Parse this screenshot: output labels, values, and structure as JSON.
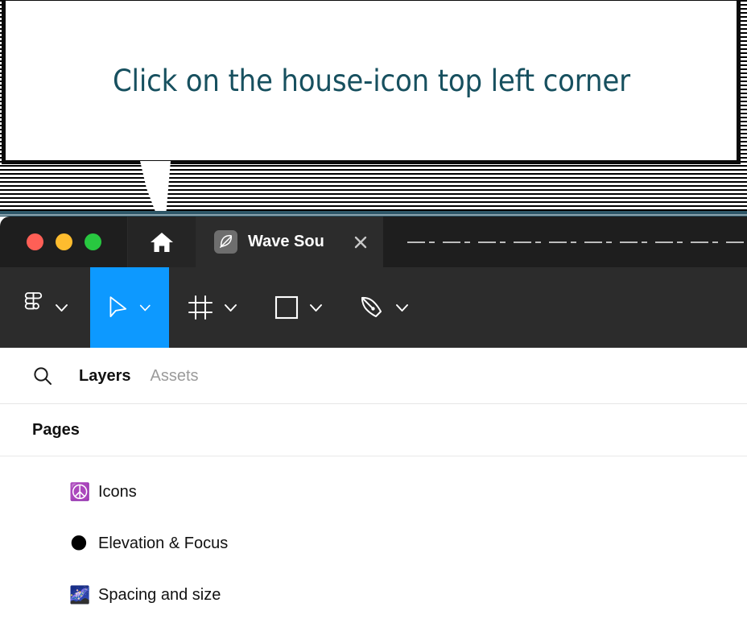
{
  "callout": {
    "text": "Click on the house-icon top left corner",
    "text_color": "#17505f",
    "border_color": "#0a0a0a",
    "background": "#ffffff"
  },
  "window": {
    "accent_blue": "#0d99ff",
    "titlebar_bg": "#1e1e1e",
    "toolbar_bg": "#2c2c2c",
    "top_strip_color": "#2d5667",
    "traffic_lights": [
      {
        "name": "close",
        "color": "#ff5f56"
      },
      {
        "name": "minimize",
        "color": "#febc2e"
      },
      {
        "name": "maximize",
        "color": "#28c840"
      }
    ],
    "home_button": {
      "icon": "house-icon"
    },
    "tab": {
      "icon": "pen-nib-icon",
      "title": "Wave Sou",
      "close_label": "×"
    }
  },
  "toolbar": {
    "tools": [
      {
        "id": "figma",
        "icon": "figma-logo-icon",
        "label": "Figma menu",
        "chevron": true,
        "selected": false
      },
      {
        "id": "move",
        "icon": "cursor-arrow-icon",
        "label": "Move",
        "chevron": true,
        "selected": true
      },
      {
        "id": "frame",
        "icon": "frame-icon",
        "label": "Frame",
        "chevron": true,
        "selected": false
      },
      {
        "id": "shape",
        "icon": "rectangle-icon",
        "label": "Shape",
        "chevron": true,
        "selected": false
      },
      {
        "id": "pen",
        "icon": "pen-tool-icon",
        "label": "Pen",
        "chevron": true,
        "selected": false
      }
    ]
  },
  "panel": {
    "search_icon": "search-icon",
    "tabs": [
      {
        "label": "Layers",
        "active": true
      },
      {
        "label": "Assets",
        "active": false
      }
    ],
    "pages_title": "Pages",
    "pages": [
      {
        "emoji": "☮️",
        "emoji_name": "peace-symbol-emoji",
        "label": "Icons"
      },
      {
        "emoji": "🌑",
        "emoji_name": "new-moon-emoji",
        "label": "Elevation & Focus"
      },
      {
        "emoji": "🌌",
        "emoji_name": "milky-way-emoji",
        "label": "Spacing and size"
      }
    ]
  }
}
